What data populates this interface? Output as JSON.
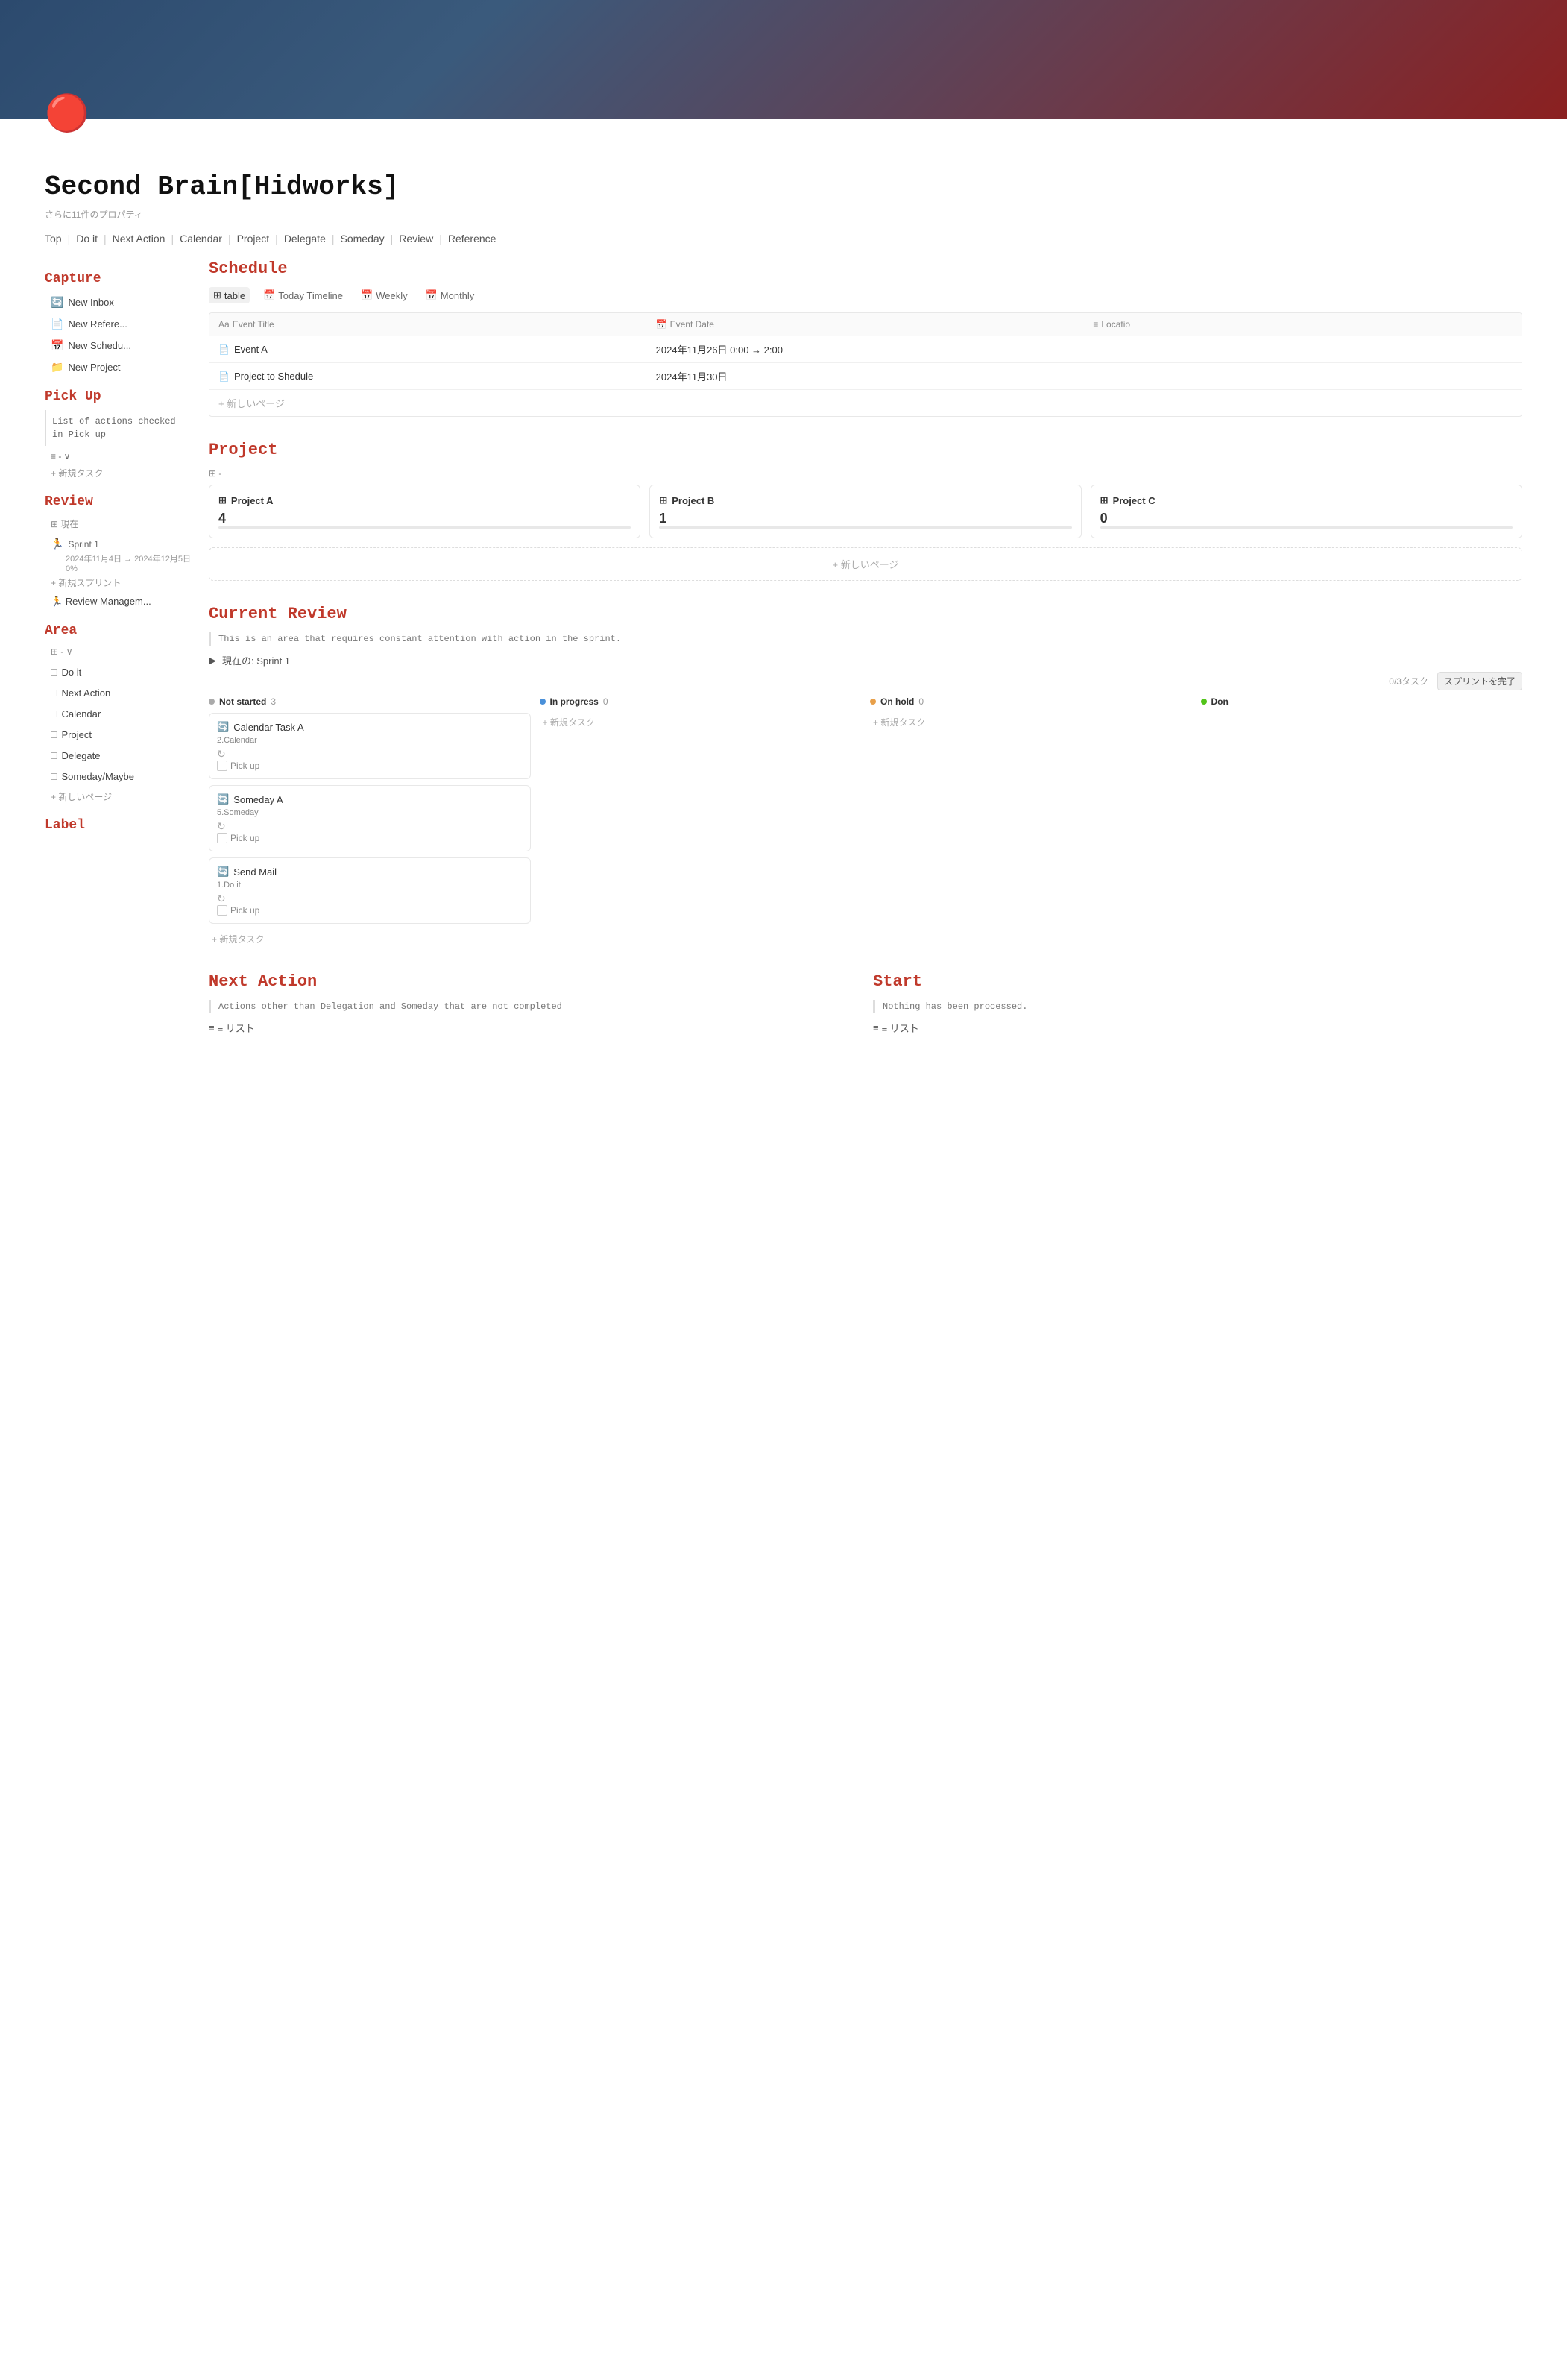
{
  "header": {
    "title": "Second Brain[Hidworks]",
    "props_label": "さらに11件のプロパティ",
    "icon": "🔴"
  },
  "tabs": [
    {
      "label": "Top"
    },
    {
      "label": "Do it"
    },
    {
      "label": "Next Action"
    },
    {
      "label": "Calendar"
    },
    {
      "label": "Project"
    },
    {
      "label": "Delegate"
    },
    {
      "label": "Someday"
    },
    {
      "label": "Review"
    },
    {
      "label": "Reference"
    }
  ],
  "sidebar": {
    "capture_title": "Capture",
    "capture_items": [
      {
        "icon": "🔄",
        "label": "New Inbox"
      },
      {
        "icon": "📄",
        "label": "New Refere..."
      },
      {
        "icon": "📅",
        "label": "New Schedu..."
      },
      {
        "icon": "📁",
        "label": "New Project"
      }
    ],
    "pickup_title": "Pick Up",
    "pickup_text": "List of actions checked in Pick up",
    "pickup_sub": "≡ - ∨",
    "new_task_label": "+ 新規タスク",
    "review_title": "Review",
    "review_db_label": "⊞ 現在",
    "sprint_icon": "🏃",
    "sprint_label": "Sprint 1",
    "sprint_dates": "2024年11月4日 → 2024年12月5日",
    "sprint_pct": "0%",
    "new_sprint_label": "+ 新規スプリント",
    "review_mgmt_label": "🏃 Review Managem...",
    "area_title": "Area",
    "area_db_label": "⊞ - ∨",
    "area_items": [
      {
        "icon": "□",
        "label": "Do it"
      },
      {
        "icon": "□",
        "label": "Next Action"
      },
      {
        "icon": "□",
        "label": "Calendar"
      },
      {
        "icon": "□",
        "label": "Project"
      },
      {
        "icon": "□",
        "label": "Delegate"
      },
      {
        "icon": "□",
        "label": "Someday/Maybe"
      }
    ],
    "new_page_label": "+ 新しいページ",
    "label_title": "Label"
  },
  "schedule": {
    "title": "Schedule",
    "view_tabs": [
      "table",
      "Today Timeline",
      "Weekly",
      "Monthly"
    ],
    "active_view": "table",
    "columns": [
      "Event Title",
      "Event Date",
      "Locatio"
    ],
    "rows": [
      {
        "icon": "📄",
        "title": "Event A",
        "date": "2024年11月26日 0:00 → 2:00",
        "location": ""
      },
      {
        "icon": "📄",
        "title": "Project to Shedule",
        "date": "2024年11月30日",
        "location": ""
      }
    ],
    "add_label": "+ 新しいページ"
  },
  "project": {
    "title": "Project",
    "db_label": "⊞ -",
    "cards": [
      {
        "icon": "⊞",
        "title": "Project A",
        "num": "4"
      },
      {
        "icon": "⊞",
        "title": "Project B",
        "num": "1"
      },
      {
        "icon": "⊞",
        "title": "Project C",
        "num": "0"
      }
    ],
    "add_label": "+ 新しいページ"
  },
  "current_review": {
    "title": "Current Review",
    "description": "This is an area that requires constant attention with action in the sprint.",
    "current_label": "現在の: Sprint 1",
    "task_count": "0/3タスク",
    "complete_btn": "スプリントを完了",
    "columns": [
      {
        "label": "Not started",
        "count": "3",
        "dot": "gray"
      },
      {
        "label": "In progress",
        "count": "0",
        "dot": "blue"
      },
      {
        "label": "On hold",
        "count": "0",
        "dot": "orange"
      },
      {
        "label": "Don",
        "count": "",
        "dot": "green"
      }
    ],
    "tasks": [
      {
        "icon": "🔄",
        "title": "Calendar Task A",
        "sub": "2.Calendar",
        "spinner": "↻",
        "checkbox_label": "Pick up"
      },
      {
        "icon": "🔄",
        "title": "Someday A",
        "sub": "5.Someday",
        "spinner": "↻",
        "checkbox_label": "Pick up"
      },
      {
        "icon": "🔄",
        "title": "Send Mail",
        "sub": "1.Do it",
        "spinner": "↻",
        "checkbox_label": "Pick up"
      }
    ],
    "add_task_label": "+ 新規タスク",
    "add_task_in_progress": "+ 新規タスク",
    "add_task_on_hold": "+ 新規タスク"
  },
  "next_action": {
    "title": "Next Action",
    "description": "Actions other than Delegation and Someday that are not completed",
    "list_label": "≡ リスト"
  },
  "start": {
    "title": "Start",
    "description": "Nothing has been processed.",
    "list_label": "≡ リスト"
  },
  "someday": {
    "section_title": "Someday",
    "items": [
      "Someday Pick up"
    ]
  },
  "send_mail": {
    "items": [
      "Send Mail 1. Do it Pick up"
    ]
  },
  "next_action_detail": {
    "items": [
      "Next Action Actions other than Delegation and Someday that are not completed"
    ]
  }
}
